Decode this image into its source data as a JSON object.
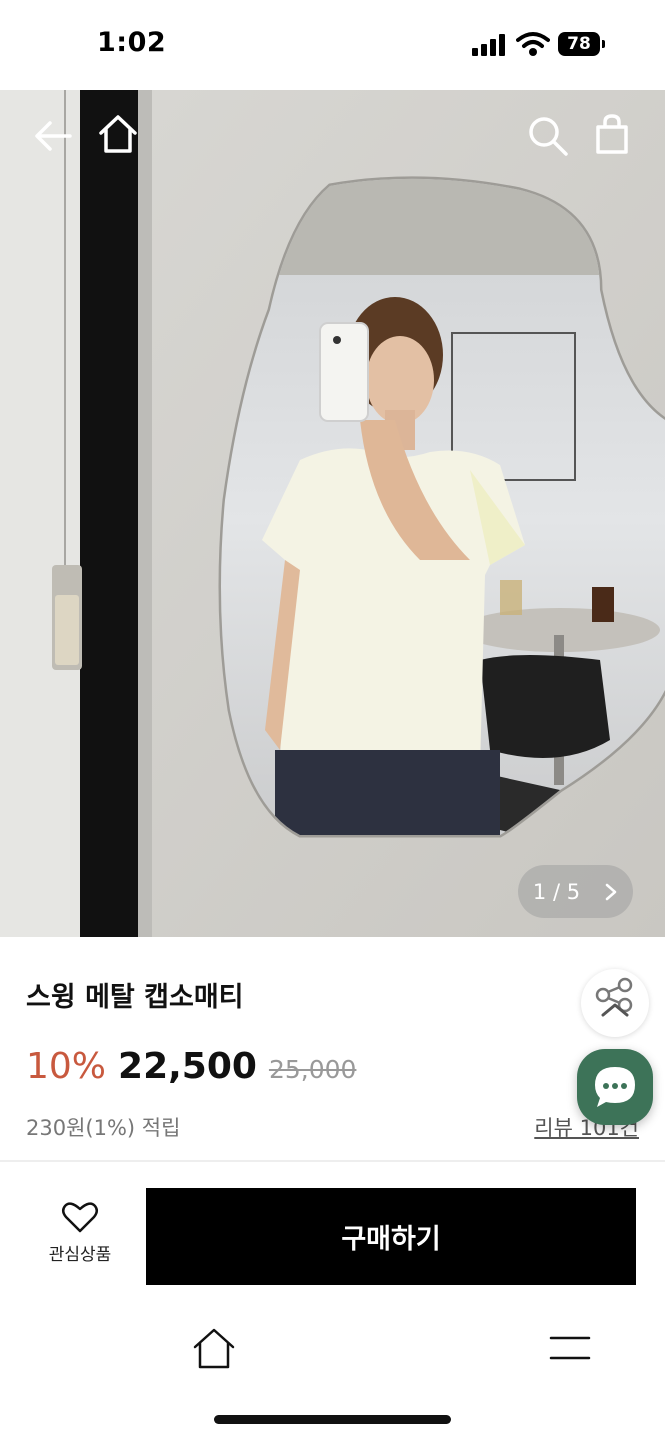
{
  "status_bar": {
    "time": "1:02",
    "battery": "78"
  },
  "icons": {
    "back": "back-arrow-icon",
    "home": "home-icon",
    "search": "search-icon",
    "cart": "shopping-bag-icon",
    "share": "share-icon",
    "chat": "chat-icon",
    "wishlist": "heart-icon",
    "menu": "menu-icon"
  },
  "gallery": {
    "current": "1",
    "separator": "/",
    "total": "5"
  },
  "product": {
    "name": "스윙 메탈 캡소매티",
    "discount": "10%",
    "price": "22,500",
    "original_price": "25,000",
    "points": "230원(1%) 적립",
    "review": "리뷰 101건"
  },
  "actions": {
    "wishlist_label": "관심상품",
    "buy_label": "구매하기"
  },
  "colors": {
    "discount": "#c8593e",
    "chat_button": "#3d7358",
    "buy_button": "#000000"
  }
}
